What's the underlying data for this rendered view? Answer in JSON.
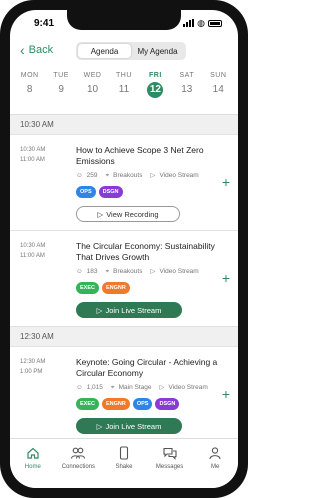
{
  "status_bar": {
    "time": "9:41"
  },
  "header": {
    "back_label": "Back",
    "tabs": [
      "Agenda",
      "My Agenda"
    ],
    "active_tab": 0
  },
  "week": [
    {
      "name": "MON",
      "date": "8"
    },
    {
      "name": "TUE",
      "date": "9"
    },
    {
      "name": "WED",
      "date": "10"
    },
    {
      "name": "THU",
      "date": "11"
    },
    {
      "name": "FRI",
      "date": "12"
    },
    {
      "name": "SAT",
      "date": "13"
    },
    {
      "name": "SUN",
      "date": "14"
    }
  ],
  "selected_day_index": 4,
  "sections": [
    {
      "time": "10:30 AM",
      "sessions": [
        {
          "start": "10:30 AM",
          "end": "11:00 AM",
          "title": "How to Achieve Scope 3 Net Zero Emissions",
          "attendees": "259",
          "location": "Breakouts",
          "stream": "Video Stream",
          "tags": [
            "OPS",
            "DSGN"
          ],
          "button": {
            "type": "outline",
            "label": "View Recording"
          }
        },
        {
          "start": "10:30 AM",
          "end": "11:00 AM",
          "title": "The Circular Economy: Sustainability That Drives Growth",
          "attendees": "183",
          "location": "Breakouts",
          "stream": "Video Stream",
          "tags": [
            "EXEC",
            "ENGNR"
          ],
          "button": {
            "type": "fill",
            "label": "Join Live Stream"
          }
        }
      ]
    },
    {
      "time": "12:30 AM",
      "sessions": [
        {
          "start": "12:30 AM",
          "end": "1:00 PM",
          "title": "Keynote: Going Circular - Achieving a Circular Economy",
          "attendees": "1,015",
          "location": "Main Stage",
          "stream": "Video Stream",
          "tags": [
            "EXEC",
            "ENGNR",
            "OPS",
            "DSGN"
          ],
          "button": {
            "type": "fill",
            "label": "Join Live Stream"
          }
        }
      ]
    }
  ],
  "tag_colors": {
    "OPS": "#2f84e8",
    "DSGN": "#8a3bd6",
    "EXEC": "#35b35a",
    "ENGNR": "#f07a2a"
  },
  "accent_color": "#2f8b63",
  "tabbar": [
    {
      "label": "Home",
      "icon": "home-icon"
    },
    {
      "label": "Connections",
      "icon": "people-icon"
    },
    {
      "label": "Shake",
      "icon": "phone-shake-icon"
    },
    {
      "label": "Messages",
      "icon": "chat-icon"
    },
    {
      "label": "Me",
      "icon": "person-icon"
    }
  ],
  "active_tab_index": 0
}
